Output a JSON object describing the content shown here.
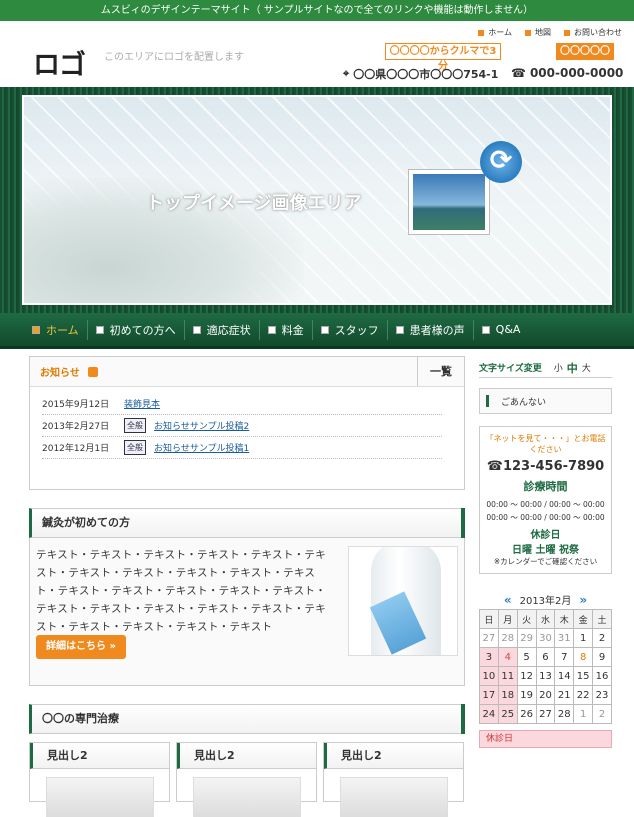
{
  "topbar": {
    "text": "ムスビィのデザインテーマサイト（ サンプルサイトなので全てのリンクや機能は動作しません）"
  },
  "header": {
    "logo": "ロゴ",
    "logo_note": "このエリアにロゴを配置します",
    "util_links": [
      "ホーム",
      "地図",
      "お問い合わせ"
    ],
    "car_button": "〇〇〇〇からクルマで3分",
    "orange_button": "〇〇〇〇〇",
    "address": "〇〇県〇〇〇市〇〇〇754-1",
    "phone": "000-000-0000"
  },
  "hero": {
    "title": "トップイメージ画像エリア"
  },
  "nav": {
    "items": [
      "ホーム",
      "初めての方へ",
      "適応症状",
      "料金",
      "スタッフ",
      "患者様の声",
      "Q&A"
    ]
  },
  "news": {
    "title": "お知らせ",
    "all_label": "一覧",
    "items": [
      {
        "date": "2015年9月12日",
        "category": "",
        "title": "装飾見本"
      },
      {
        "date": "2013年2月27日",
        "category": "全般",
        "title": "お知らせサンプル投稿2"
      },
      {
        "date": "2012年12月1日",
        "category": "全般",
        "title": "お知らせサンプル投稿1"
      }
    ]
  },
  "first_time": {
    "title": "鍼灸が初めての方",
    "body": "テキスト・テキスト・テキスト・テキスト・テキスト・テキスト・テキスト・テキスト・テキスト・テキスト・テキスト・テキスト・テキスト・テキスト・テキスト・テキスト・テキスト・テキスト・テキスト・テキスト・テキスト・テキスト・テキスト・テキスト・テキスト・テキスト",
    "more_label": "詳細はこちら »"
  },
  "specialty": {
    "title": "〇〇の専門治療"
  },
  "cards": [
    {
      "title": "見出し2"
    },
    {
      "title": "見出し2"
    },
    {
      "title": "見出し2"
    }
  ],
  "sidebar": {
    "font_size_label": "文字サイズ変更",
    "font_sizes": [
      "小",
      "中",
      "大"
    ],
    "search_text": "ごあんない",
    "contact_note": "「ネットを見て・・・」とお電話ください",
    "contact_phone": "123-456-7890",
    "hours_title": "診療時間",
    "times": [
      "00:00 ～ 00:00 / 00:00 ～ 00:00",
      "00:00 ～ 00:00 / 00:00 ～ 00:00"
    ],
    "closed_title": "休診日",
    "closed_days": "日曜 土曜 祝祭",
    "calendar_note": "※カレンダーでご確認ください"
  },
  "calendar": {
    "title": "2013年2月",
    "prev": "«",
    "next": "»",
    "headers": [
      "日",
      "月",
      "火",
      "水",
      "木",
      "金",
      "土"
    ],
    "weeks": [
      [
        "27",
        "28",
        "29",
        "30",
        "31",
        "1",
        "2"
      ],
      [
        "3",
        "4",
        "5",
        "6",
        "7",
        "8",
        "9"
      ],
      [
        "10",
        "11",
        "12",
        "13",
        "14",
        "15",
        "16"
      ],
      [
        "17",
        "18",
        "19",
        "20",
        "21",
        "22",
        "23"
      ],
      [
        "24",
        "25",
        "26",
        "27",
        "28",
        "1",
        "2"
      ]
    ],
    "legend": "休診日"
  }
}
